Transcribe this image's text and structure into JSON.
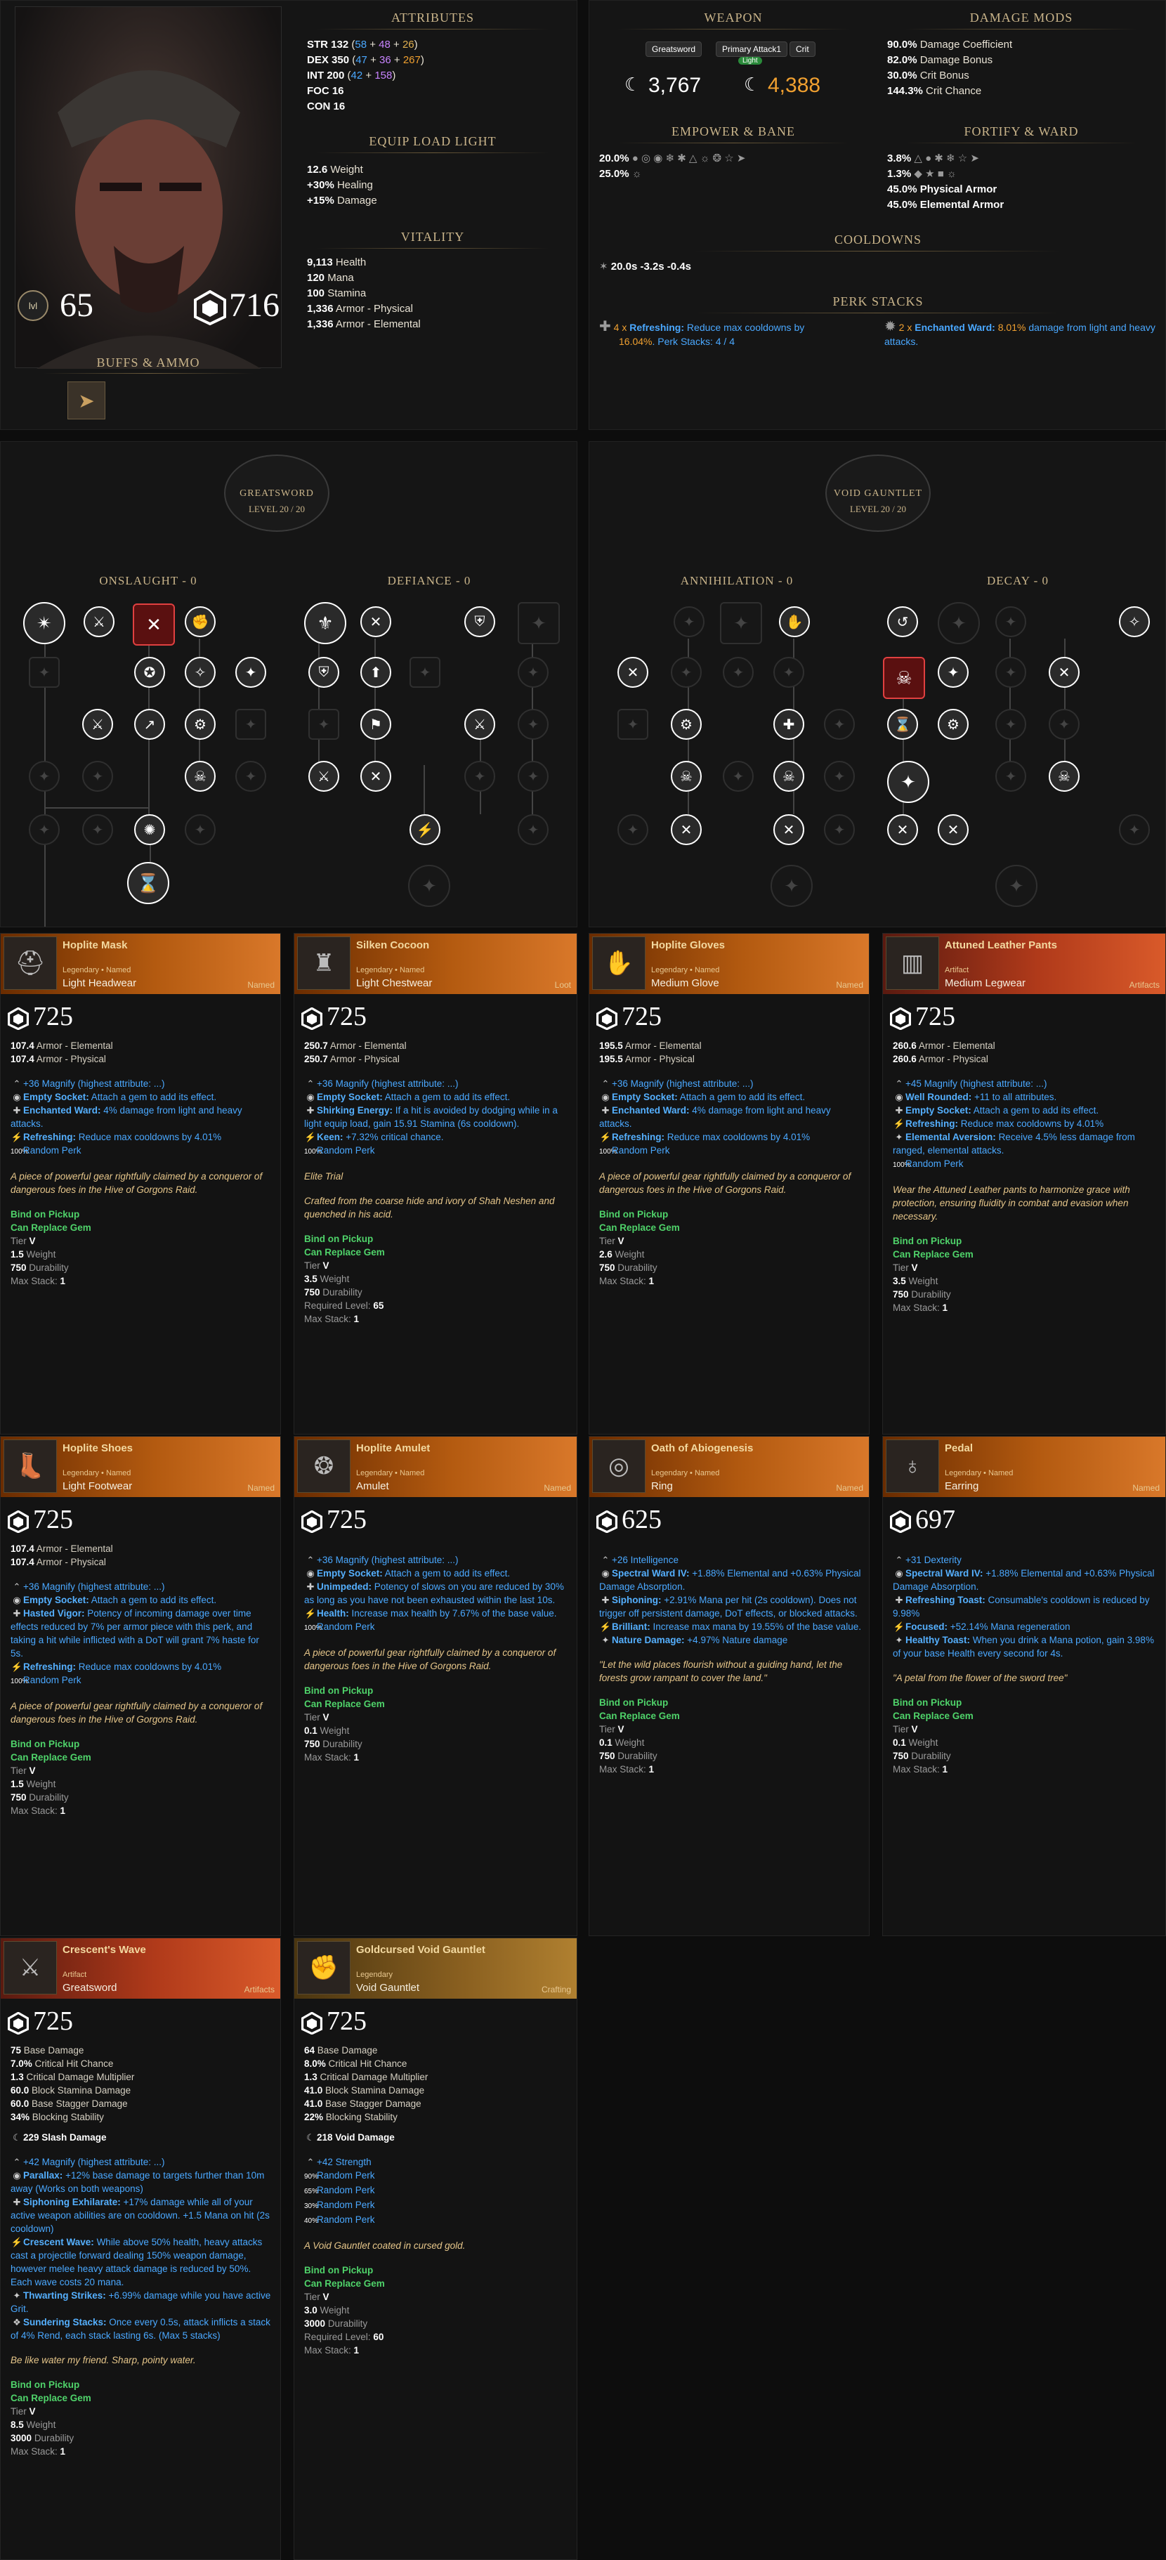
{
  "char": {
    "level": "65",
    "gear_score": "716",
    "buffs_title": "BUFFS & AMMO"
  },
  "attributes": {
    "title": "ATTRIBUTES",
    "str": {
      "label": "STR",
      "total": "132",
      "base": "58",
      "plus1": "48",
      "plus2": "26"
    },
    "dex": {
      "label": "DEX",
      "total": "350",
      "base": "47",
      "plus1": "36",
      "plus2": "267"
    },
    "int": {
      "label": "INT",
      "total": "200",
      "base": "42",
      "plus1": "158"
    },
    "foc": "FOC 16",
    "con": "CON 16"
  },
  "equip_load": {
    "title": "EQUIP LOAD LIGHT",
    "weight": "12.6",
    "weight_l": "Weight",
    "healing": "+30%",
    "healing_l": "Healing",
    "damage": "+15%",
    "damage_l": "Damage"
  },
  "vitality": {
    "title": "VITALITY",
    "rows": [
      [
        "9,113",
        "Health"
      ],
      [
        "120",
        "Mana"
      ],
      [
        "100",
        "Stamina"
      ],
      [
        "1,336",
        "Armor - Physical"
      ],
      [
        "1,336",
        "Armor - Elemental"
      ]
    ]
  },
  "weapon": {
    "title": "WEAPON",
    "tabs": [
      "Greatsword",
      "Primary Attack1",
      "Crit"
    ],
    "badge": "Light",
    "val1": "3,767",
    "val2": "4,388"
  },
  "damage_mods": {
    "title": "DAMAGE MODS",
    "rows": [
      [
        "90.0%",
        "Damage Coefficient"
      ],
      [
        "82.0%",
        "Damage Bonus"
      ],
      [
        "30.0%",
        "Crit Bonus"
      ],
      [
        "144.3%",
        "Crit Chance"
      ]
    ]
  },
  "empower": {
    "title": "EMPOWER & BANE",
    "row1": "20.0%",
    "row2": "25.0%"
  },
  "fortify": {
    "title": "FORTIFY & WARD",
    "row1": "3.8%",
    "row2": "1.3%",
    "row3": "45.0% Physical Armor",
    "row4": "45.0% Elemental Armor"
  },
  "cooldowns": {
    "title": "COOLDOWNS",
    "values": "20.0s  -3.2s  -0.4s"
  },
  "perk_stacks": {
    "title": "PERK STACKS",
    "p1": {
      "count": "4 x",
      "name": "Refreshing:",
      "desc": "Reduce max cooldowns by",
      "pct": "16.04%",
      "tail": ". Perk Stacks: 4 / 4"
    },
    "p2": {
      "count": "2 x",
      "name": "Enchanted Ward:",
      "pct": "8.01%",
      "desc": "damage from light and heavy attacks."
    }
  },
  "trees": {
    "greatsword": {
      "name": "GREATSWORD",
      "level": "LEVEL 20 / 20",
      "left": "ONSLAUGHT - 0",
      "right": "DEFIANCE - 0"
    },
    "void": {
      "name": "VOID GAUNTLET",
      "level": "LEVEL 20 / 20",
      "left": "ANNIHILATION - 0",
      "right": "DECAY - 0"
    }
  },
  "items": [
    {
      "name": "Hoplite Mask",
      "sub": "Legendary • Named",
      "type": "Light Headwear",
      "tag": "Named",
      "gs": "725",
      "icon": "helmet-icon",
      "stats": [
        [
          "107.4",
          "Armor - Elemental"
        ],
        [
          "107.4",
          "Armor - Physical"
        ]
      ],
      "perks": [
        [
          "+36 Magnify (highest attribute: ...)",
          ""
        ],
        [
          "Empty Socket:",
          "Attach a gem to add its effect."
        ],
        [
          "Enchanted Ward:",
          "4% damage from light and heavy attacks."
        ],
        [
          "Refreshing:",
          "Reduce max cooldowns by 4.01%"
        ],
        [
          "Random Perk",
          "100%"
        ]
      ],
      "flavor": "A piece of powerful gear rightfully claimed by a conqueror of dangerous foes in the Hive of Gorgons Raid.",
      "bind": "Bind on Pickup",
      "gem": "Can Replace Gem",
      "tier": "V",
      "weight": "1.5",
      "durability": "750",
      "maxstack": "1"
    },
    {
      "name": "Silken Cocoon",
      "sub": "Legendary • Named",
      "type": "Light Chestwear",
      "tag": "Loot",
      "gs": "725",
      "icon": "chest-armor-icon",
      "stats": [
        [
          "250.7",
          "Armor - Elemental"
        ],
        [
          "250.7",
          "Armor - Physical"
        ]
      ],
      "perks": [
        [
          "+36 Magnify (highest attribute: ...)",
          ""
        ],
        [
          "Empty Socket:",
          "Attach a gem to add its effect."
        ],
        [
          "Shirking Energy:",
          "If a hit is avoided by dodging while in a light equip load, gain 15.91 Stamina (6s cooldown)."
        ],
        [
          "Keen:",
          "+7.32% critical chance."
        ],
        [
          "Random Perk",
          "100%"
        ]
      ],
      "extra": "Elite Trial",
      "flavor": "Crafted from the coarse hide and ivory of Shah Neshen and quenched in his acid.",
      "bind": "Bind on Pickup",
      "gem": "Can Replace Gem",
      "tier": "V",
      "weight": "3.5",
      "durability": "750",
      "reqlevel": "65",
      "maxstack": "1"
    },
    {
      "name": "Hoplite Gloves",
      "sub": "Legendary • Named",
      "type": "Medium Glove",
      "tag": "Named",
      "gs": "725",
      "icon": "glove-icon",
      "stats": [
        [
          "195.5",
          "Armor - Elemental"
        ],
        [
          "195.5",
          "Armor - Physical"
        ]
      ],
      "perks": [
        [
          "+36 Magnify (highest attribute: ...)",
          ""
        ],
        [
          "Empty Socket:",
          "Attach a gem to add its effect."
        ],
        [
          "Enchanted Ward:",
          "4% damage from light and heavy attacks."
        ],
        [
          "Refreshing:",
          "Reduce max cooldowns by 4.01%"
        ],
        [
          "Random Perk",
          "100%"
        ]
      ],
      "flavor": "A piece of powerful gear rightfully claimed by a conqueror of dangerous foes in the Hive of Gorgons Raid.",
      "bind": "Bind on Pickup",
      "gem": "Can Replace Gem",
      "tier": "V",
      "weight": "2.6",
      "durability": "750",
      "maxstack": "1"
    },
    {
      "name": "Attuned Leather Pants",
      "sub": "Artifact",
      "type": "Medium Legwear",
      "tag": "Artifacts",
      "gs": "725",
      "icon": "pants-icon",
      "stats": [
        [
          "260.6",
          "Armor - Elemental"
        ],
        [
          "260.6",
          "Armor - Physical"
        ]
      ],
      "perks": [
        [
          "+45 Magnify (highest attribute: ...)",
          ""
        ],
        [
          "Well Rounded:",
          "+11 to all attributes."
        ],
        [
          "Empty Socket:",
          "Attach a gem to add its effect."
        ],
        [
          "Refreshing:",
          "Reduce max cooldowns by 4.01%"
        ],
        [
          "Elemental Aversion:",
          "Receive 4.5% less damage from ranged, elemental attacks."
        ],
        [
          "Random Perk",
          "100%"
        ]
      ],
      "flavor": "Wear the Attuned Leather pants to harmonize grace with protection, ensuring fluidity in combat and evasion when necessary.",
      "bind": "Bind on Pickup",
      "gem": "Can Replace Gem",
      "tier": "V",
      "weight": "3.5",
      "durability": "750",
      "maxstack": "1"
    },
    {
      "name": "Hoplite Shoes",
      "sub": "Legendary • Named",
      "type": "Light Footwear",
      "tag": "Named",
      "gs": "725",
      "icon": "boots-icon",
      "stats": [
        [
          "107.4",
          "Armor - Elemental"
        ],
        [
          "107.4",
          "Armor - Physical"
        ]
      ],
      "perks": [
        [
          "+36 Magnify (highest attribute: ...)",
          ""
        ],
        [
          "Empty Socket:",
          "Attach a gem to add its effect."
        ],
        [
          "Hasted Vigor:",
          "Potency of incoming damage over time effects reduced by 7% per armor piece with this perk, and taking a hit while inflicted with a DoT will grant 7% haste for 5s."
        ],
        [
          "Refreshing:",
          "Reduce max cooldowns by 4.01%"
        ],
        [
          "Random Perk",
          "100%"
        ]
      ],
      "flavor": "A piece of powerful gear rightfully claimed by a conqueror of dangerous foes in the Hive of Gorgons Raid.",
      "bind": "Bind on Pickup",
      "gem": "Can Replace Gem",
      "tier": "V",
      "weight": "1.5",
      "durability": "750",
      "maxstack": "1"
    },
    {
      "name": "Hoplite Amulet",
      "sub": "Legendary • Named",
      "type": "Amulet",
      "tag": "Named",
      "gs": "725",
      "icon": "amulet-icon",
      "stats": [],
      "perks": [
        [
          "+36 Magnify (highest attribute: ...)",
          ""
        ],
        [
          "Empty Socket:",
          "Attach a gem to add its effect."
        ],
        [
          "Unimpeded:",
          "Potency of slows on you are reduced by 30% as long as you have not been exhausted within the last 10s."
        ],
        [
          "Health:",
          "Increase max health by 7.67% of the base value."
        ],
        [
          "Random Perk",
          "100%"
        ]
      ],
      "flavor": "A piece of powerful gear rightfully claimed by a conqueror of dangerous foes in the Hive of Gorgons Raid.",
      "bind": "Bind on Pickup",
      "gem": "Can Replace Gem",
      "tier": "V",
      "weight": "0.1",
      "durability": "750",
      "maxstack": "1"
    },
    {
      "name": "Oath of Abiogenesis",
      "sub": "Legendary • Named",
      "type": "Ring",
      "tag": "Named",
      "gs": "625",
      "icon": "ring-icon",
      "stats": [],
      "perks": [
        [
          "+26 Intelligence",
          ""
        ],
        [
          "Spectral Ward IV:",
          "+1.88% Elemental and +0.63% Physical Damage Absorption."
        ],
        [
          "Siphoning:",
          "+2.91% Mana per hit (2s cooldown). Does not trigger off persistent damage, DoT effects, or blocked attacks."
        ],
        [
          "Brilliant:",
          "Increase max mana by 19.55% of the base value."
        ],
        [
          "Nature Damage:",
          "+4.97% Nature damage"
        ]
      ],
      "flavor": "\"Let the wild places flourish without a guiding hand, let the forests grow rampant to cover the land.\"",
      "bind": "Bind on Pickup",
      "gem": "Can Replace Gem",
      "tier": "V",
      "weight": "0.1",
      "durability": "750",
      "maxstack": "1"
    },
    {
      "name": "Pedal",
      "sub": "Legendary • Named",
      "type": "Earring",
      "tag": "Named",
      "gs": "697",
      "icon": "earring-icon",
      "stats": [],
      "perks": [
        [
          "+31 Dexterity",
          ""
        ],
        [
          "Spectral Ward IV:",
          "+1.88% Elemental and +0.63% Physical Damage Absorption."
        ],
        [
          "Refreshing Toast:",
          "Consumable's cooldown is reduced by 9.98%"
        ],
        [
          "Focused:",
          "+52.14% Mana regeneration"
        ],
        [
          "Healthy Toast:",
          "When you drink a Mana potion, gain 3.98% of your base Health every second for 4s."
        ]
      ],
      "flavor": "\"A petal from the flower of the sword tree\"",
      "bind": "Bind on Pickup",
      "gem": "Can Replace Gem",
      "tier": "V",
      "weight": "0.1",
      "durability": "750",
      "maxstack": "1"
    },
    {
      "name": "Crescent's Wave",
      "sub": "Artifact",
      "type": "Greatsword",
      "tag": "Artifacts",
      "gs": "725",
      "icon": "greatsword-icon",
      "stats": [
        [
          "75",
          "Base Damage"
        ],
        [
          "7.0%",
          "Critical Hit Chance"
        ],
        [
          "1.3",
          "Critical Damage Multiplier"
        ],
        [
          "60.0",
          "Block Stamina Damage"
        ],
        [
          "60.0",
          "Base Stagger Damage"
        ],
        [
          "34%",
          "Blocking Stability"
        ]
      ],
      "dmg": "229 Slash Damage",
      "perks": [
        [
          "+42 Magnify (highest attribute: ...)",
          ""
        ],
        [
          "Parallax:",
          "+12% base damage to targets further than 10m away (Works on both weapons)"
        ],
        [
          "Siphoning Exhilarate:",
          "+17% damage while all of your active weapon abilities are on cooldown. +1.5 Mana on hit (2s cooldown)"
        ],
        [
          "Crescent Wave:",
          "While above 50% health, heavy attacks cast a projectile forward dealing 150% weapon damage, however melee heavy attack damage is reduced by 50%. Each wave costs 20 mana."
        ],
        [
          "Thwarting Strikes:",
          "+6.99% damage while you have active Grit."
        ],
        [
          "Sundering Stacks:",
          "Once every 0.5s, attack inflicts a stack of 4% Rend, each stack lasting 6s. (Max 5 stacks)"
        ]
      ],
      "flavor": "Be like water my friend. Sharp, pointy water.",
      "bind": "Bind on Pickup",
      "gem": "Can Replace Gem",
      "tier": "V",
      "weight": "8.5",
      "durability": "3000",
      "maxstack": "1"
    },
    {
      "name": "Goldcursed Void Gauntlet",
      "sub": "Legendary",
      "type": "Void Gauntlet",
      "tag": "Crafting",
      "gs": "725",
      "icon": "gauntlet-icon",
      "stats": [
        [
          "64",
          "Base Damage"
        ],
        [
          "8.0%",
          "Critical Hit Chance"
        ],
        [
          "1.3",
          "Critical Damage Multiplier"
        ],
        [
          "41.0",
          "Block Stamina Damage"
        ],
        [
          "41.0",
          "Base Stagger Damage"
        ],
        [
          "22%",
          "Blocking Stability"
        ]
      ],
      "dmg": "218 Void Damage",
      "perks": [
        [
          "+42 Strength",
          ""
        ],
        [
          "Random Perk",
          "90%"
        ],
        [
          "Random Perk",
          "65%"
        ],
        [
          "Random Perk",
          "30%"
        ],
        [
          "Random Perk",
          "40%"
        ]
      ],
      "flavor": "A Void Gauntlet coated in cursed gold.",
      "bind": "Bind on Pickup",
      "gem": "Can Replace Gem",
      "tier": "V",
      "weight": "3.0",
      "durability": "3000",
      "reqlevel": "60",
      "maxstack": "1"
    }
  ],
  "labels": {
    "tier": "Tier",
    "weight": "Weight",
    "durability": "Durability",
    "reqlevel": "Required Level:",
    "maxstack": "Max Stack:"
  }
}
